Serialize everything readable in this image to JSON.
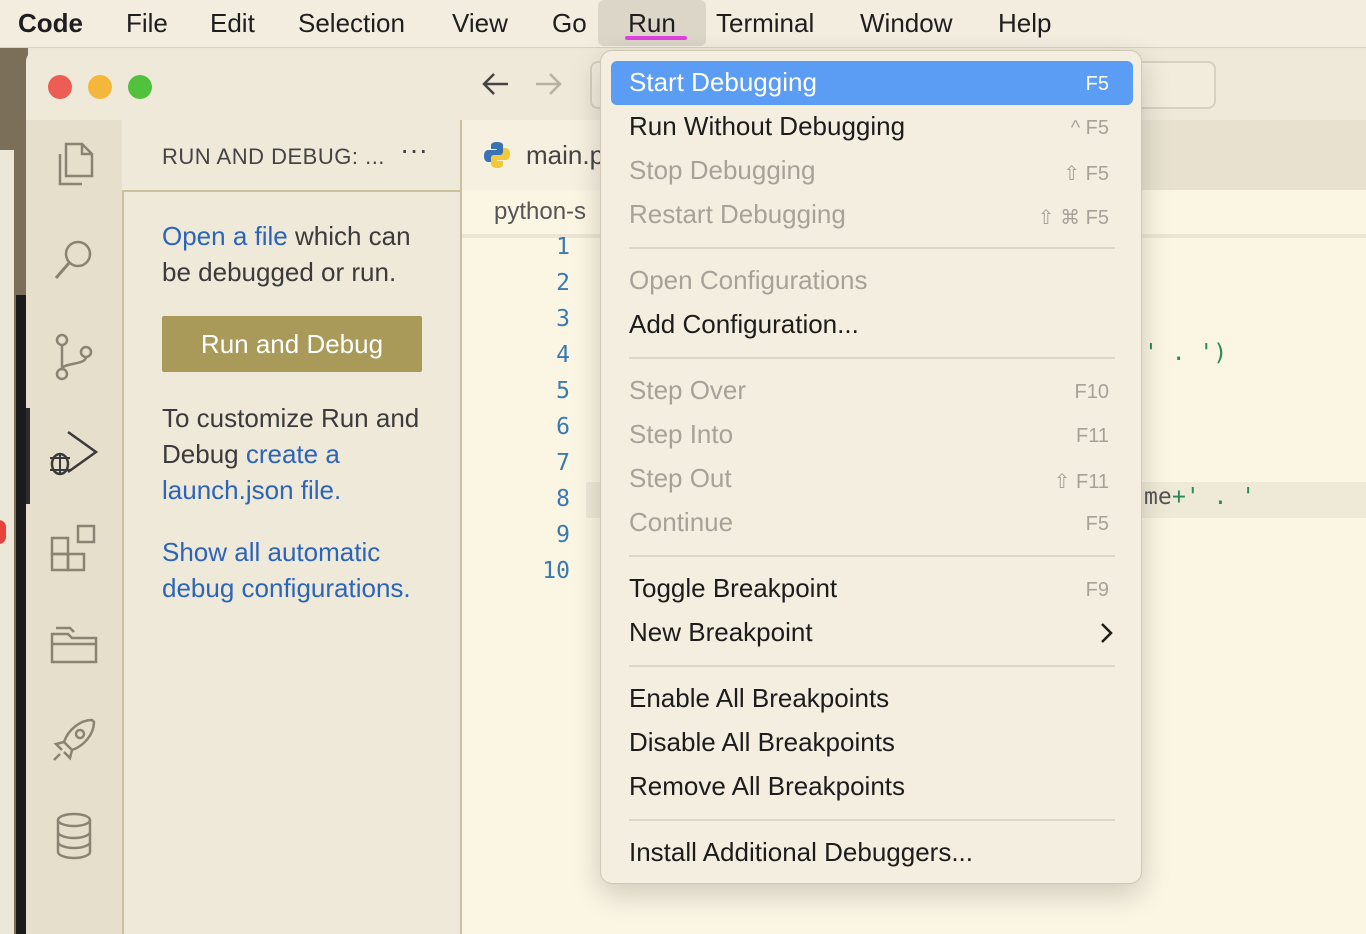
{
  "menubar": {
    "app": "Code",
    "items": [
      "File",
      "Edit",
      "Selection",
      "View",
      "Go",
      "Run",
      "Terminal",
      "Window",
      "Help"
    ]
  },
  "titlebar": {
    "back_icon": "arrow-left-icon",
    "forward_icon": "arrow-right-icon"
  },
  "activity_bar": {
    "icons": [
      "files-icon",
      "search-icon",
      "source-control-icon",
      "run-debug-icon",
      "extensions-icon",
      "folders-icon",
      "rocket-icon",
      "database-icon"
    ]
  },
  "sidebar": {
    "title": "RUN AND DEBUG: ...",
    "more": "···",
    "open_prefix": "Open a file",
    "open_suffix": " which can be debugged or run.",
    "run_button": "Run and Debug",
    "customize_prefix": "To customize Run and Debug ",
    "customize_link": "create a launch.json file",
    "customize_suffix": ".",
    "show_link": "Show all automatic debug configurations",
    "show_suffix": "."
  },
  "editor": {
    "tab_label": "main.p",
    "breadcrumb": "python-s",
    "line_numbers": [
      "1",
      "2",
      "3",
      "4",
      "5",
      "6",
      "7",
      "8",
      "9",
      "10"
    ],
    "line4_end": "' . ')",
    "line8_end_a": "me",
    "line8_end_b": "+' . '"
  },
  "run_menu": {
    "items": [
      {
        "label": "Start Debugging",
        "shortcut": "F5",
        "highlighted": true,
        "disabled": false
      },
      {
        "label": "Run Without Debugging",
        "shortcut": "^ F5",
        "disabled": false
      },
      {
        "label": "Stop Debugging",
        "shortcut": "⇧ F5",
        "disabled": true
      },
      {
        "label": "Restart Debugging",
        "shortcut": "⇧ ⌘ F5",
        "disabled": true
      },
      {
        "label": "Open Configurations",
        "shortcut": "",
        "disabled": true
      },
      {
        "label": "Add Configuration...",
        "shortcut": "",
        "disabled": false
      },
      {
        "label": "Step Over",
        "shortcut": "F10",
        "disabled": true
      },
      {
        "label": "Step Into",
        "shortcut": "F11",
        "disabled": true
      },
      {
        "label": "Step Out",
        "shortcut": "⇧ F11",
        "disabled": true
      },
      {
        "label": "Continue",
        "shortcut": "F5",
        "disabled": true
      },
      {
        "label": "Toggle Breakpoint",
        "shortcut": "F9",
        "disabled": false
      },
      {
        "label": "New Breakpoint",
        "shortcut": "",
        "submenu": true,
        "disabled": false
      },
      {
        "label": "Enable All Breakpoints",
        "shortcut": "",
        "disabled": false
      },
      {
        "label": "Disable All Breakpoints",
        "shortcut": "",
        "disabled": false
      },
      {
        "label": "Remove All Breakpoints",
        "shortcut": "",
        "disabled": false
      },
      {
        "label": "Install Additional Debuggers...",
        "shortcut": "",
        "disabled": false
      }
    ]
  },
  "colors": {
    "highlight": "#5b9cf5",
    "link": "#2c64b8",
    "button": "#a99a5a",
    "menu_underline": "#e040e0"
  }
}
